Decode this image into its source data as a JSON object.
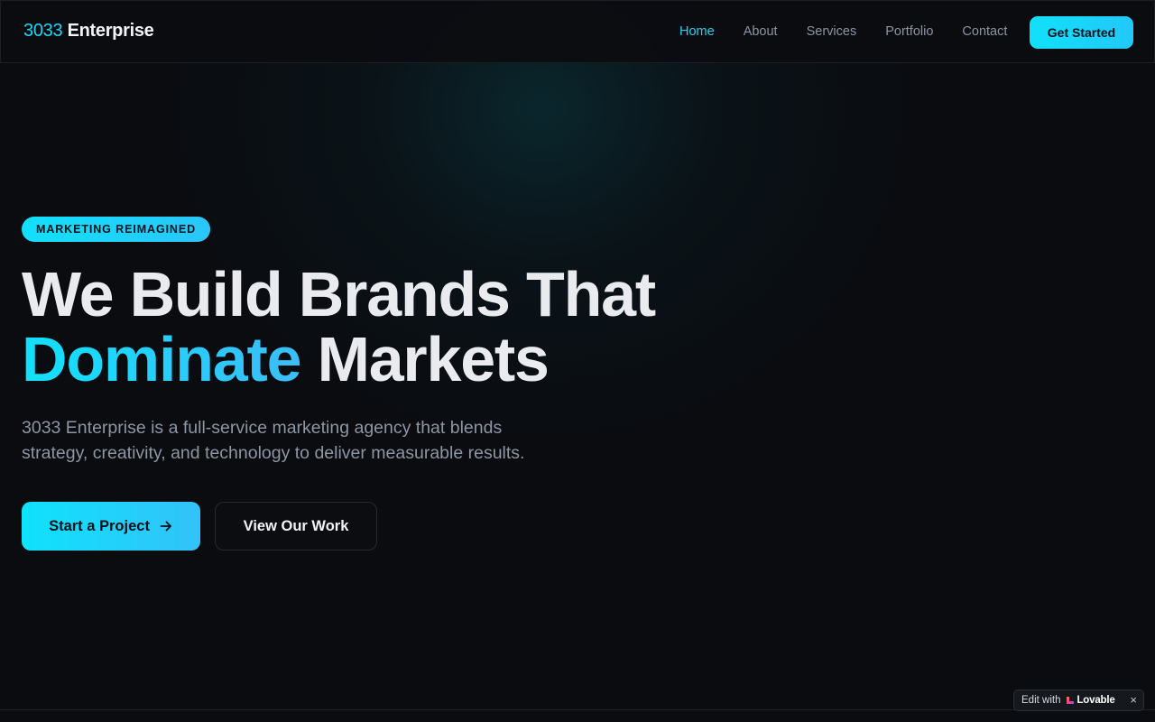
{
  "header": {
    "brand_number": "3033",
    "brand_name": "Enterprise",
    "nav": {
      "home": "Home",
      "about": "About",
      "services": "Services",
      "portfolio": "Portfolio",
      "contact": "Contact"
    },
    "active_nav": "Home",
    "cta_label": "Get Started"
  },
  "hero": {
    "badge": "MARKETING REIMAGINED",
    "headline_line1": "We Build Brands That",
    "headline_accent": "Dominate",
    "headline_rest": " Markets",
    "subtext_line1": "3033 Enterprise is a full-service marketing agency that blends",
    "subtext_line2": "strategy, creativity, and technology to deliver measurable results.",
    "primary_cta": "Start a Project",
    "primary_cta_icon": "arrow-right-icon",
    "secondary_cta": "View Our Work"
  },
  "lovable_badge": {
    "edit_text": "Edit with",
    "brand": "Lovable",
    "close_icon": "close-icon"
  },
  "colors": {
    "accent": "#1fd3f4",
    "background": "#0a0c10",
    "text": "#e9ebef",
    "muted": "#8d96a4"
  }
}
